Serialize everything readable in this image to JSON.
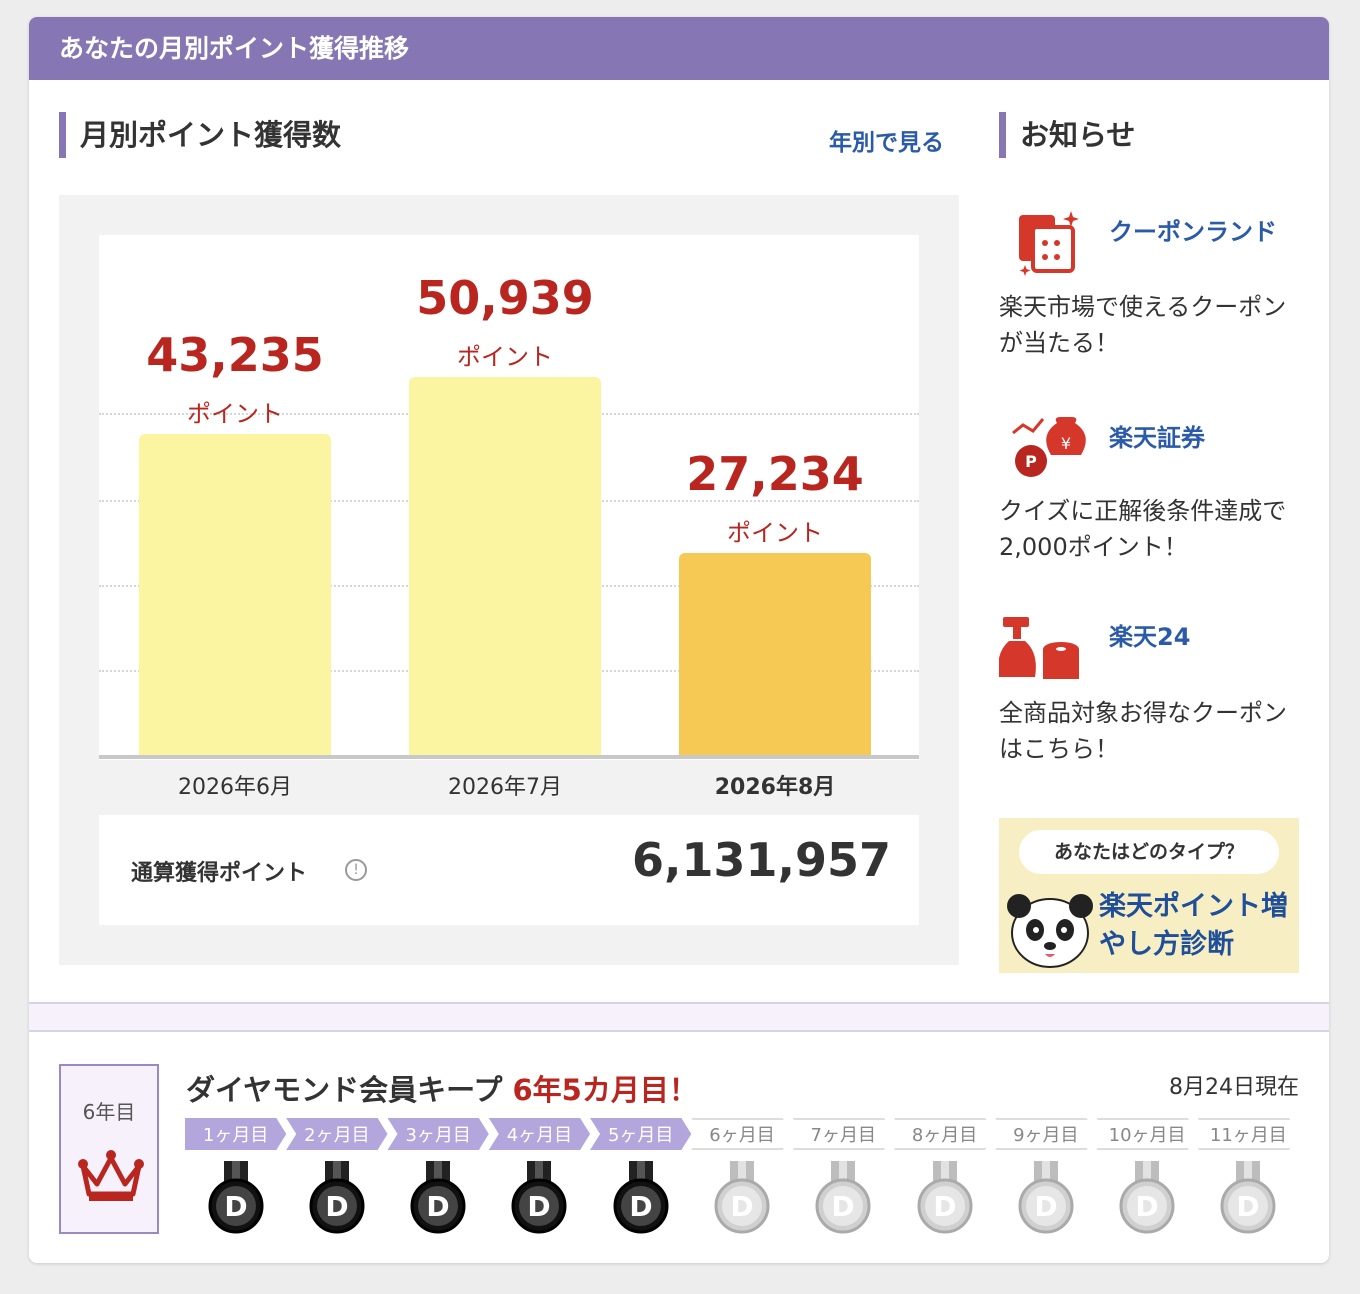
{
  "header": {
    "title": "あなたの月別ポイント獲得推移"
  },
  "monthly": {
    "title": "月別ポイント獲得数",
    "yearly_link": "年別で見る",
    "unit": "ポイント",
    "total_label": "通算獲得ポイント",
    "total_value": "6,131,957"
  },
  "chart_data": {
    "type": "bar",
    "categories": [
      "2026年6月",
      "2026年7月",
      "2026年8月"
    ],
    "values": [
      43235,
      50939,
      27234
    ],
    "value_labels": [
      "43,235",
      "50,939",
      "27,234"
    ],
    "unit": "ポイント",
    "highlight_index": 2,
    "ylim": [
      0,
      70000
    ],
    "colors": {
      "bar": "#fbf4a1",
      "highlight": "#f6c954",
      "value_text": "#b8261f"
    }
  },
  "news": {
    "title": "お知らせ",
    "items": [
      {
        "title": "クーポンランド",
        "desc": "楽天市場で使えるクーポンが当たる！",
        "icon": "coupon-icon"
      },
      {
        "title": "楽天証券",
        "desc": "クイズに正解後条件達成で2,000ポイント！",
        "icon": "securities-icon"
      },
      {
        "title": "楽天24",
        "desc": "全商品対象お得なクーポンはこちら！",
        "icon": "daily-goods-icon"
      }
    ],
    "banner": {
      "bubble": "あなたはどのタイプ？",
      "text": "楽天ポイント増やし方診断"
    }
  },
  "keep": {
    "year_label": "6年目",
    "title": "ダイヤモンド会員キープ",
    "highlight": "6年5カ月目！",
    "date": "8月24日現在",
    "steps": [
      "1ヶ月目",
      "2ヶ月目",
      "3ヶ月目",
      "4ヶ月目",
      "5ヶ月目",
      "6ヶ月目",
      "7ヶ月目",
      "8ヶ月目",
      "9ヶ月目",
      "10ヶ月目",
      "11ヶ月目"
    ],
    "completed": 5,
    "medal_letter": "D"
  },
  "colors": {
    "accent": "#8677b4",
    "link": "#2a5aa8",
    "red": "#b8261f"
  }
}
